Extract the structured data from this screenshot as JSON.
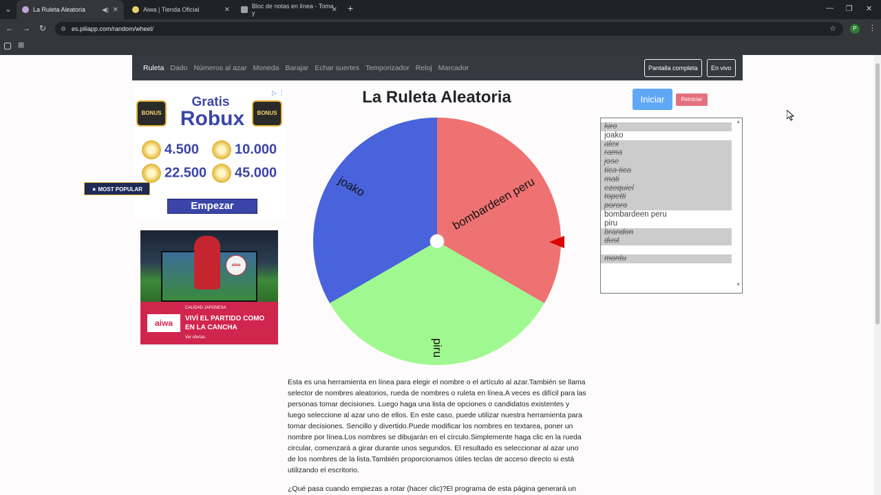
{
  "browser": {
    "tabs": [
      {
        "title": "La Ruleta Aleatoria",
        "active": true
      },
      {
        "title": "Aiwa | Tienda Oficial",
        "active": false
      },
      {
        "title": "Bloc de notas en línea - Toma y",
        "active": false
      }
    ],
    "new_tab": "+",
    "url": "es.piliapp.com/random/wheel/",
    "profile_initial": "P"
  },
  "nav": {
    "links": [
      "Ruleta",
      "Dado",
      "Números al azar",
      "Moneda",
      "Barajar",
      "Echar suertes",
      "Temporizador",
      "Reloj",
      "Marcador"
    ],
    "fullscreen": "Pantalla completa",
    "live": "En vivo"
  },
  "ad1": {
    "bonus": "BONUS",
    "gratis": "Gratis",
    "robux": "Robux",
    "amounts": [
      "4.500",
      "10.000",
      "22.500",
      "45.000"
    ],
    "popular": "★ MOST POPULAR",
    "cta": "Empezar"
  },
  "ad2": {
    "brand": "aiwa",
    "ball_brand": "aiwa",
    "tag": "CALIDAD JAPONESA",
    "headline": "VIVÍ EL PARTIDO COMO EN LA CANCHA",
    "cta": "Ver ofertas"
  },
  "main": {
    "title": "La Ruleta Aleatoria",
    "start": "Iniciar",
    "reset": "Reiniciar"
  },
  "wheel": {
    "segments": [
      {
        "label": "bombardeen peru",
        "color": "#ef7272"
      },
      {
        "label": "piru",
        "color": "#a0f990"
      },
      {
        "label": "joako",
        "color": "#4863dc"
      }
    ],
    "pointer_color": "#dd0000"
  },
  "names": [
    {
      "text": "kiro",
      "struck": true
    },
    {
      "text": "joako",
      "struck": false
    },
    {
      "text": "alex",
      "struck": true
    },
    {
      "text": "rama",
      "struck": true
    },
    {
      "text": "jose",
      "struck": true
    },
    {
      "text": "tica tica",
      "struck": true
    },
    {
      "text": "mati",
      "struck": true
    },
    {
      "text": "ezequiel",
      "struck": true
    },
    {
      "text": "topetti",
      "struck": true
    },
    {
      "text": "pororo",
      "struck": true
    },
    {
      "text": "bombardeen peru",
      "struck": false
    },
    {
      "text": "piru",
      "struck": false
    },
    {
      "text": "brandon",
      "struck": true
    },
    {
      "text": "dust",
      "struck": true
    },
    {
      "text": "",
      "struck": false
    },
    {
      "text": "montu",
      "struck": true
    }
  ],
  "description": "Esta es una herramienta en línea para elegir el nombre o el artículo al azar.También se llama selector de nombres aleatorios, rueda de nombres o ruleta en línea.A veces es difícil para las personas tomar decisiones. Luego haga una lista de opciones o candidatos existentes y luego seleccione al azar uno de ellos. En este caso, puede utilizar nuestra herramienta para tomar decisiones. Sencillo y divertido.Puede modificar los nombres en textarea, poner un nombre por línea.Los nombres se dibujarán en el círculo.Simplemente haga clic en la rueda circular, comenzará a girar durante unos segundos. El resultado es seleccionar al azar uno de los nombres de la lista.También proporcionamos útiles teclas de acceso directo si está utilizando el escritorio.",
  "description2": "¿Qué pasa cuando empiezas a rotar (hacer clic)?El programa de esta página generará un"
}
